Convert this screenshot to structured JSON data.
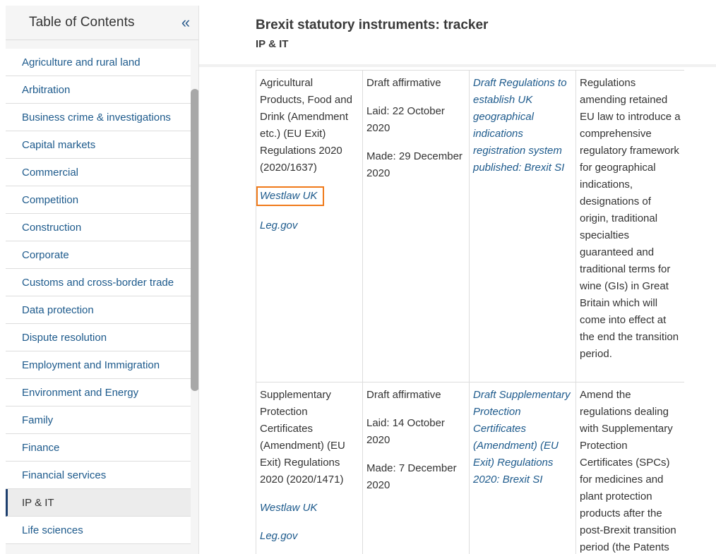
{
  "sidebar": {
    "title": "Table of Contents",
    "collapse_label": "«",
    "items": [
      {
        "label": "Agriculture and rural land"
      },
      {
        "label": "Arbitration"
      },
      {
        "label": "Business crime & investigations"
      },
      {
        "label": "Capital markets"
      },
      {
        "label": "Commercial"
      },
      {
        "label": "Competition"
      },
      {
        "label": "Construction"
      },
      {
        "label": "Corporate"
      },
      {
        "label": "Customs and cross-border trade"
      },
      {
        "label": "Data protection"
      },
      {
        "label": "Dispute resolution"
      },
      {
        "label": "Employment and Immigration"
      },
      {
        "label": "Environment and Energy"
      },
      {
        "label": "Family"
      },
      {
        "label": "Finance"
      },
      {
        "label": "Financial services"
      },
      {
        "label": "IP & IT"
      },
      {
        "label": "Life sciences"
      }
    ],
    "active_index": 16
  },
  "header": {
    "title": "Brexit statutory instruments: tracker",
    "subtitle": "IP & IT"
  },
  "rows": [
    {
      "instrument": "Agricultural Products, Food and Drink (Amendment etc.) (EU Exit) Regulations 2020 (2020/1637)",
      "westlaw": "Westlaw UK",
      "leggov": "Leg.gov",
      "procedure": "Draft affirmative",
      "laid": "Laid: 22 October 2020",
      "made": "Made: 29 December 2020",
      "article": "Draft Regulations to establish UK geographical indications registration system published: Brexit SI",
      "summary": "Regulations amending retained EU law to introduce a comprehensive regulatory framework for geographical indications, designations of origin, traditional specialties guaranteed and traditional terms for wine (GIs) in Great Britain which will come into effect at the end the transition period."
    },
    {
      "instrument": "Supplementary Protection Certificates (Amendment) (EU Exit) Regulations 2020 (2020/1471)",
      "westlaw": "Westlaw UK",
      "leggov": "Leg.gov",
      "procedure": "Draft affirmative",
      "laid": "Laid: 14 October 2020",
      "made": "Made: 7 December 2020",
      "article": "Draft Supplementary Protection Certificates (Amendment) (EU Exit) Regulations 2020: Brexit SI",
      "summary": "Amend the regulations dealing with Supplementary Protection Certificates (SPCs) for medicines and plant protection products after the post-Brexit transition period (the Patents"
    }
  ],
  "colors": {
    "link": "#1d5a8c",
    "highlight": "#f07a1a",
    "active_border": "#1d3f6e"
  }
}
